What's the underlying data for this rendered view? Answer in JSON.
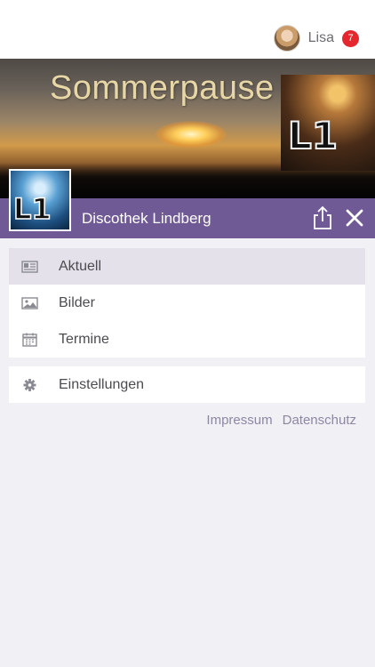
{
  "user": {
    "name": "Lisa",
    "notification_count": "7"
  },
  "banner": {
    "title": "Sommerpause",
    "logo_text": "L1"
  },
  "header": {
    "title": "Discothek Lindberg"
  },
  "menu": {
    "items": [
      {
        "label": "Aktuell",
        "icon": "newspaper-icon",
        "active": true
      },
      {
        "label": "Bilder",
        "icon": "image-icon",
        "active": false
      },
      {
        "label": "Termine",
        "icon": "calendar-icon",
        "active": false
      }
    ],
    "settings": {
      "label": "Einstellungen",
      "icon": "gear-icon"
    }
  },
  "footer": {
    "impressum": "Impressum",
    "datenschutz": "Datenschutz"
  },
  "colors": {
    "header": "#6f5a95",
    "badge": "#e5262f",
    "active_row": "#e4e1ea",
    "link": "#8e87a4"
  }
}
